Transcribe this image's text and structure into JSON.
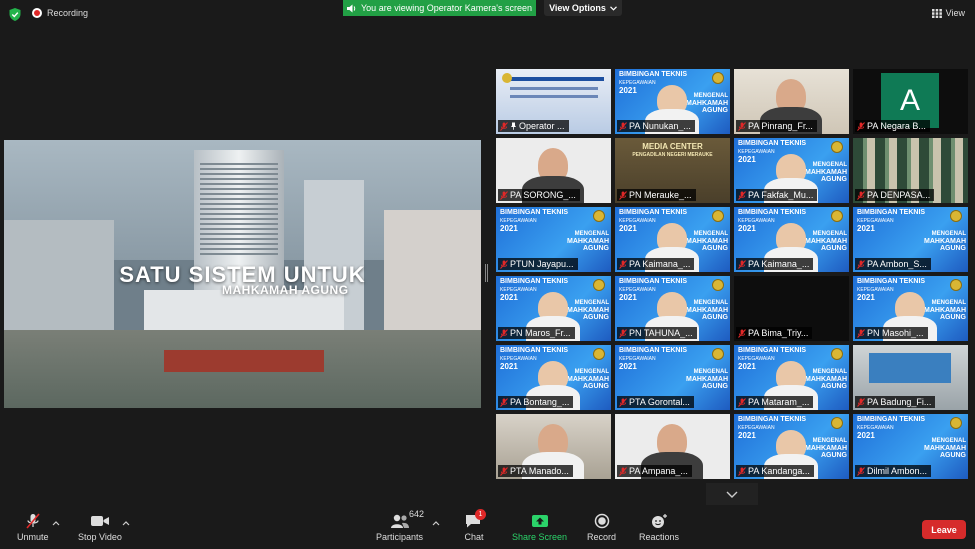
{
  "topbar": {
    "recording_label": "Recording",
    "viewing_banner": "You are viewing Operator Kamera's screen",
    "view_options_label": "View Options",
    "view_label": "View"
  },
  "shared_screen": {
    "title": "SATU SISTEM UNTUK",
    "subtitle": "MAHKAMAH AGUNG"
  },
  "banner": {
    "line1": "BIMBINGAN TEKNIS",
    "line2": "KEPEGAWAIAN",
    "year": "2021",
    "right1": "MENGENAL",
    "right2": "MAHKAMAH",
    "right3": "AGUNG"
  },
  "tiles": [
    {
      "name": "Operator ...",
      "bg": "slide",
      "active": true,
      "pinned": true
    },
    {
      "name": "PA Nunukan_...",
      "bg": "blue"
    },
    {
      "name": "PA Pinrang_Fr...",
      "bg": "room"
    },
    {
      "name": "PA Negara B...",
      "bg": "dark",
      "avatar": "A"
    },
    {
      "name": "PA SORONG_...",
      "bg": "plain"
    },
    {
      "name": "PN Merauke_...",
      "bg": "green",
      "media": "MEDIA CENTER",
      "media2": "PENGADILAN NEGERI MERAUKE"
    },
    {
      "name": "PA Fakfak_Mu...",
      "bg": "blue"
    },
    {
      "name": "PA DENPASA...",
      "bg": "shelf"
    },
    {
      "name": "PTUN Jayapu...",
      "bg": "blue"
    },
    {
      "name": "PA Kaimana_...",
      "bg": "blue"
    },
    {
      "name": "PA Kaimana_...",
      "bg": "blue"
    },
    {
      "name": "PA Ambon_S...",
      "bg": "blue"
    },
    {
      "name": "PN Maros_Fr...",
      "bg": "blue"
    },
    {
      "name": "PN TAHUNA_...",
      "bg": "blue"
    },
    {
      "name": "PA Bima_Triy...",
      "bg": "dark"
    },
    {
      "name": "PN Masohi_...",
      "bg": "blue"
    },
    {
      "name": "PA Bontang_...",
      "bg": "blue"
    },
    {
      "name": "PTA Gorontal...",
      "bg": "blue"
    },
    {
      "name": "PA Mataram_...",
      "bg": "blue"
    },
    {
      "name": "PA Badung_Fi...",
      "bg": "hall"
    },
    {
      "name": "PTA Manado...",
      "bg": "office"
    },
    {
      "name": "PA Ampana_...",
      "bg": "plain"
    },
    {
      "name": "PA Kandanga...",
      "bg": "blue"
    },
    {
      "name": "Dilmil Ambon...",
      "bg": "blue"
    }
  ],
  "toolbar": {
    "unmute": "Unmute",
    "stop_video": "Stop Video",
    "participants": "Participants",
    "participants_count": "642",
    "chat": "Chat",
    "chat_badge": "1",
    "share_screen": "Share Screen",
    "record": "Record",
    "reactions": "Reactions",
    "leave": "Leave"
  },
  "colors": {
    "viewing_banner": "#22a045",
    "share_screen_label": "#2bd36a",
    "leave_button": "#d62b2b",
    "active_speaker": "#e7d43a"
  }
}
